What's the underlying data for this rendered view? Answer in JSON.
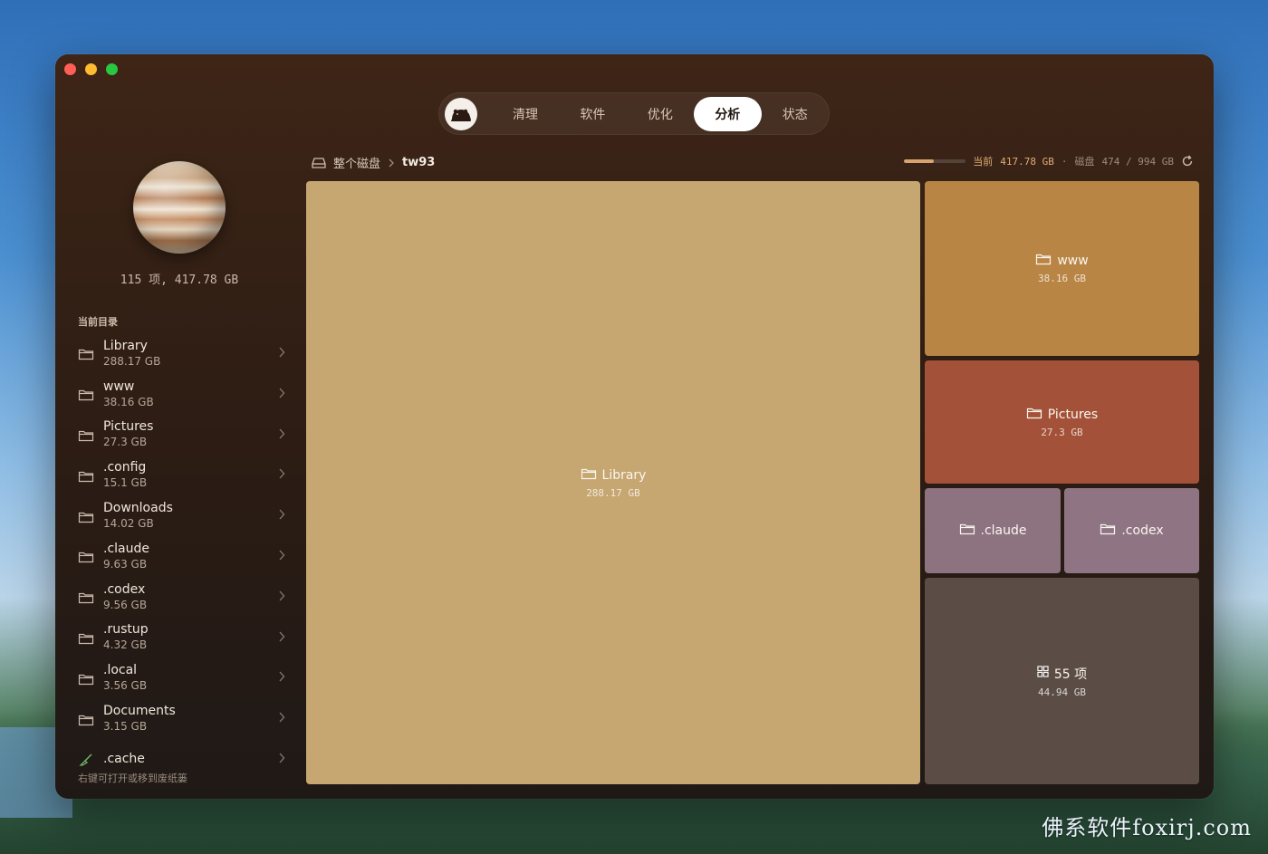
{
  "window": {
    "tabs": [
      {
        "label": "清理",
        "active": false
      },
      {
        "label": "软件",
        "active": false
      },
      {
        "label": "优化",
        "active": false
      },
      {
        "label": "分析",
        "active": true
      },
      {
        "label": "状态",
        "active": false
      }
    ]
  },
  "sidebar": {
    "summary": "115 项, 417.78 GB",
    "section_title": "当前目录",
    "items": [
      {
        "name": "Library",
        "size": "288.17 GB",
        "icon": "folder-icon"
      },
      {
        "name": "www",
        "size": "38.16 GB",
        "icon": "folder-icon"
      },
      {
        "name": "Pictures",
        "size": "27.3 GB",
        "icon": "folder-icon"
      },
      {
        "name": ".config",
        "size": "15.1 GB",
        "icon": "folder-icon"
      },
      {
        "name": "Downloads",
        "size": "14.02 GB",
        "icon": "folder-icon"
      },
      {
        "name": ".claude",
        "size": "9.63 GB",
        "icon": "folder-icon"
      },
      {
        "name": ".codex",
        "size": "9.56 GB",
        "icon": "folder-icon"
      },
      {
        "name": ".rustup",
        "size": "4.32 GB",
        "icon": "folder-icon"
      },
      {
        "name": ".local",
        "size": "3.56 GB",
        "icon": "folder-icon"
      },
      {
        "name": "Documents",
        "size": "3.15 GB",
        "icon": "folder-icon"
      },
      {
        "name": ".cache",
        "size": "",
        "icon": "broom-icon"
      }
    ],
    "hint": "右键可打开或移到废纸篓"
  },
  "breadcrumb": {
    "root": "整个磁盘",
    "current": "tw93"
  },
  "disk_info": {
    "current_label": "当前",
    "current_value": "417.78 GB",
    "sep": "·",
    "disk_label": "磁盘",
    "disk_value": "474 / 994 GB",
    "usage_fraction": 0.477
  },
  "treemap": {
    "cells": [
      {
        "name": "Library",
        "size": "288.17 GB",
        "color": "#c6a671",
        "icon": "folder-icon"
      },
      {
        "name": "www",
        "size": "38.16 GB",
        "color": "#b98545",
        "icon": "folder-icon"
      },
      {
        "name": "Pictures",
        "size": "27.3 GB",
        "color": "#a35239",
        "icon": "folder-icon"
      },
      {
        "name": ".claude",
        "size": "",
        "color": "#8d7280",
        "icon": "folder-icon"
      },
      {
        "name": ".codex",
        "size": "",
        "color": "#8f7584",
        "icon": "folder-icon"
      },
      {
        "name": "55 项",
        "size": "44.94 GB",
        "color": "#5b4d46",
        "icon": "grid-icon"
      }
    ]
  },
  "watermark": "佛系软件foxirj.com",
  "colors": {
    "accent": "#e1ad76",
    "window_bg": "#2b1c14"
  }
}
